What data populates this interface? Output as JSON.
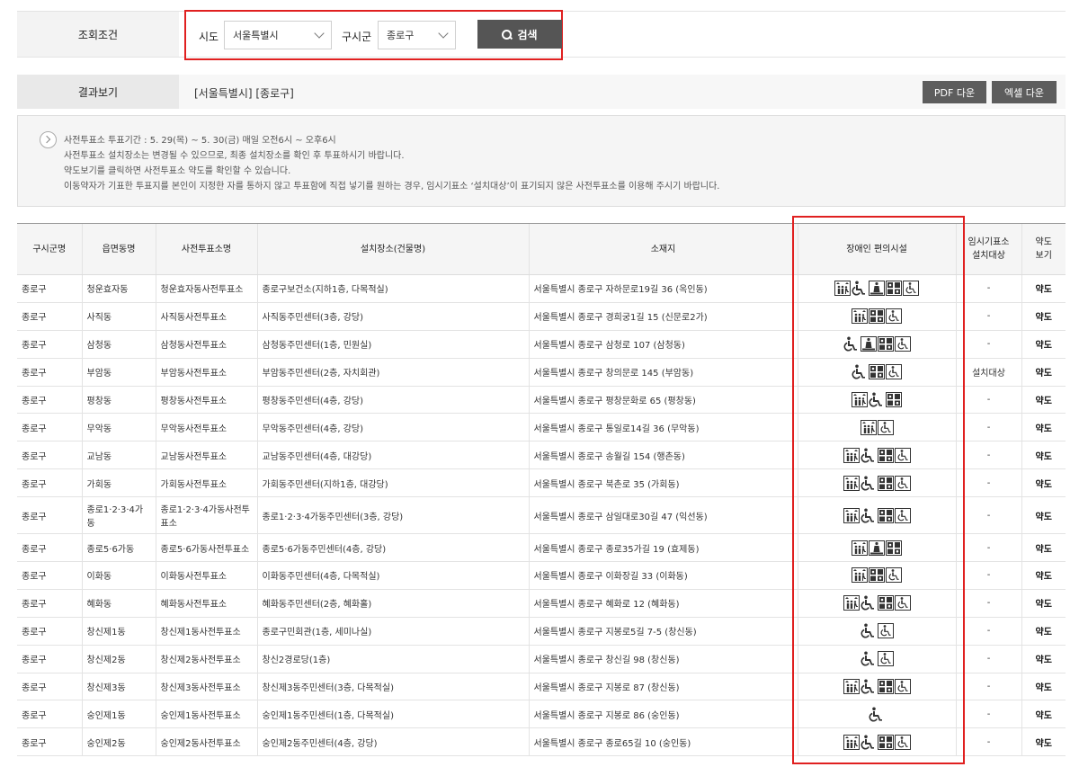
{
  "search": {
    "label": "조회조건",
    "sido_label": "시도",
    "sido_value": "서울특별시",
    "gugun_label": "구시군",
    "gugun_value": "종로구",
    "button": "검색"
  },
  "result": {
    "label": "결과보기",
    "value": "[서울특별시] [종로구]",
    "pdf_button": "PDF 다운",
    "excel_button": "엑셀 다운"
  },
  "notice": [
    "사전투표소 투표기간 : 5. 29(목) ~ 5. 30(금) 매일 오전6시 ~ 오후6시",
    "사전투표소 설치장소는 변경될 수 있으므로, 최종 설치장소를 확인 후 투표하시기 바랍니다.",
    "약도보기를 클릭하면 사전투표소 약도를 확인할 수 있습니다.",
    "이동약자가 기표한 투표지를 본인이 지정한 자를 통하지 않고 투표함에 직접 넣기를 원하는 경우, 임시기표소 ‘설치대상’이 표기되지 않은 사전투표소를 이용해 주시기 바랍니다."
  ],
  "table": {
    "headers": [
      "구시군명",
      "읍면동명",
      "사전투표소명",
      "설치장소(건물명)",
      "소재지",
      "장애인 편의시설",
      "임시기표소\n설치대상",
      "약도\n보기"
    ],
    "rows": [
      {
        "gu": "종로구",
        "dong": "청운효자동",
        "name": "청운효자동사전투표소",
        "place": "종로구보건소(지하1층, 다목적실)",
        "addr": "서울특별시 종로구 자하문로19길 36 (옥인동)",
        "icons": [
          "elevator-icon",
          "wheelchair-icon",
          "ramp-icon",
          "braille-icon",
          "accessible-sign-icon"
        ],
        "temp": "-",
        "map": "약도"
      },
      {
        "gu": "종로구",
        "dong": "사직동",
        "name": "사직동사전투표소",
        "place": "사직동주민센터(3층, 강당)",
        "addr": "서울특별시 종로구 경희궁1길 15 (신문로2가)",
        "icons": [
          "elevator-icon",
          "braille-icon",
          "accessible-sign-icon"
        ],
        "temp": "-",
        "map": "약도"
      },
      {
        "gu": "종로구",
        "dong": "삼청동",
        "name": "삼청동사전투표소",
        "place": "삼청동주민센터(1층, 민원실)",
        "addr": "서울특별시 종로구 삼청로 107 (삼청동)",
        "icons": [
          "wheelchair-icon",
          "ramp-icon",
          "braille-icon",
          "accessible-sign-icon"
        ],
        "temp": "-",
        "map": "약도"
      },
      {
        "gu": "종로구",
        "dong": "부암동",
        "name": "부암동사전투표소",
        "place": "부암동주민센터(2층, 자치회관)",
        "addr": "서울특별시 종로구 창의문로 145 (부암동)",
        "icons": [
          "wheelchair-icon",
          "braille-icon",
          "accessible-sign-icon"
        ],
        "temp": "설치대상",
        "map": "약도"
      },
      {
        "gu": "종로구",
        "dong": "평창동",
        "name": "평창동사전투표소",
        "place": "평창동주민센터(4층, 강당)",
        "addr": "서울특별시 종로구 평창문화로 65 (평창동)",
        "icons": [
          "elevator-icon",
          "wheelchair-icon",
          "braille-icon"
        ],
        "temp": "-",
        "map": "약도"
      },
      {
        "gu": "종로구",
        "dong": "무악동",
        "name": "무악동사전투표소",
        "place": "무악동주민센터(4층, 강당)",
        "addr": "서울특별시 종로구 통일로14길 36 (무악동)",
        "icons": [
          "elevator-icon",
          "accessible-sign-icon"
        ],
        "temp": "-",
        "map": "약도"
      },
      {
        "gu": "종로구",
        "dong": "교남동",
        "name": "교남동사전투표소",
        "place": "교남동주민센터(4층, 대강당)",
        "addr": "서울특별시 종로구 송월길 154 (행촌동)",
        "icons": [
          "elevator-icon",
          "wheelchair-icon",
          "braille-icon",
          "accessible-sign-icon"
        ],
        "temp": "-",
        "map": "약도"
      },
      {
        "gu": "종로구",
        "dong": "가회동",
        "name": "가회동사전투표소",
        "place": "가회동주민센터(지하1층, 대강당)",
        "addr": "서울특별시 종로구 북촌로 35 (가회동)",
        "icons": [
          "elevator-icon",
          "wheelchair-icon",
          "braille-icon",
          "accessible-sign-icon"
        ],
        "temp": "-",
        "map": "약도"
      },
      {
        "gu": "종로구",
        "dong": "종로1·2·3·4가동",
        "name": "종로1·2·3·4가동사전투표소",
        "place": "종로1·2·3·4가동주민센터(3층, 강당)",
        "addr": "서울특별시 종로구 삼일대로30길 47 (익선동)",
        "icons": [
          "elevator-icon",
          "wheelchair-icon",
          "braille-icon",
          "accessible-sign-icon"
        ],
        "temp": "-",
        "map": "약도",
        "tall": true
      },
      {
        "gu": "종로구",
        "dong": "종로5·6가동",
        "name": "종로5·6가동사전투표소",
        "place": "종로5·6가동주민센터(4층, 강당)",
        "addr": "서울특별시 종로구 종로35가길 19 (효제동)",
        "icons": [
          "elevator-icon",
          "ramp-icon",
          "braille-icon"
        ],
        "temp": "-",
        "map": "약도"
      },
      {
        "gu": "종로구",
        "dong": "이화동",
        "name": "이화동사전투표소",
        "place": "이화동주민센터(4층, 다목적실)",
        "addr": "서울특별시 종로구 이화장길 33 (이화동)",
        "icons": [
          "elevator-icon",
          "braille-icon",
          "accessible-sign-icon"
        ],
        "temp": "-",
        "map": "약도"
      },
      {
        "gu": "종로구",
        "dong": "혜화동",
        "name": "혜화동사전투표소",
        "place": "혜화동주민센터(2층, 혜화홀)",
        "addr": "서울특별시 종로구 혜화로 12 (혜화동)",
        "icons": [
          "elevator-icon",
          "wheelchair-icon",
          "braille-icon",
          "accessible-sign-icon"
        ],
        "temp": "-",
        "map": "약도"
      },
      {
        "gu": "종로구",
        "dong": "창신제1동",
        "name": "창신제1동사전투표소",
        "place": "종로구민회관(1층, 세미나실)",
        "addr": "서울특별시 종로구 지봉로5길 7-5 (창신동)",
        "icons": [
          "wheelchair-icon",
          "accessible-sign-icon"
        ],
        "temp": "-",
        "map": "약도"
      },
      {
        "gu": "종로구",
        "dong": "창신제2동",
        "name": "창신제2동사전투표소",
        "place": "창신2경로당(1층)",
        "addr": "서울특별시 종로구 창신길 98 (창신동)",
        "icons": [
          "wheelchair-icon",
          "accessible-sign-icon"
        ],
        "temp": "-",
        "map": "약도"
      },
      {
        "gu": "종로구",
        "dong": "창신제3동",
        "name": "창신제3동사전투표소",
        "place": "창신제3동주민센터(3층, 다목적실)",
        "addr": "서울특별시 종로구 지봉로 87 (창신동)",
        "icons": [
          "elevator-icon",
          "wheelchair-icon",
          "braille-icon",
          "accessible-sign-icon"
        ],
        "temp": "-",
        "map": "약도"
      },
      {
        "gu": "종로구",
        "dong": "숭인제1동",
        "name": "숭인제1동사전투표소",
        "place": "숭인제1동주민센터(1층, 다목적실)",
        "addr": "서울특별시 종로구 지봉로 86 (숭인동)",
        "icons": [
          "wheelchair-icon"
        ],
        "temp": "-",
        "map": "약도"
      },
      {
        "gu": "종로구",
        "dong": "숭인제2동",
        "name": "숭인제2동사전투표소",
        "place": "숭인제2동주민센터(4층, 강당)",
        "addr": "서울특별시 종로구 종로65길 10 (숭인동)",
        "icons": [
          "elevator-icon",
          "wheelchair-icon",
          "braille-icon",
          "accessible-sign-icon"
        ],
        "temp": "-",
        "map": "약도"
      }
    ]
  }
}
